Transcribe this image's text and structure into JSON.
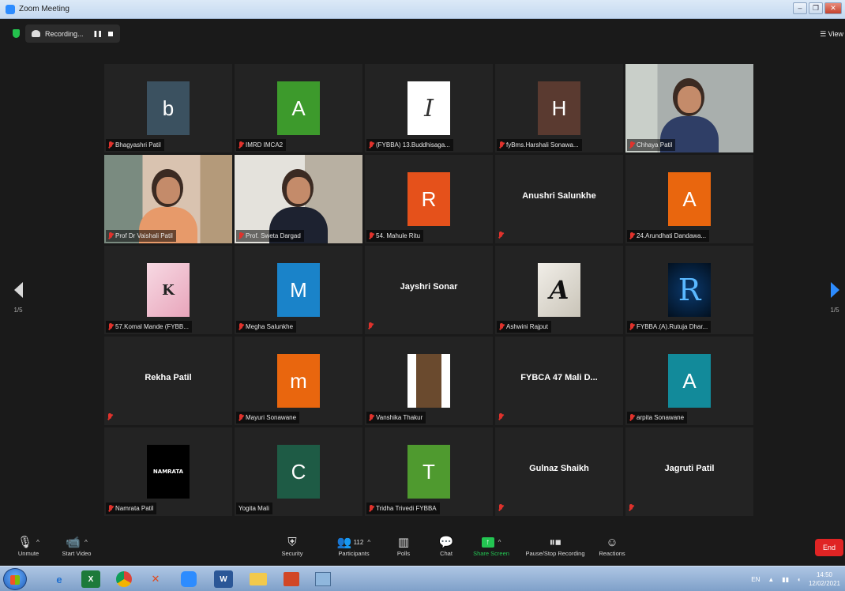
{
  "window": {
    "title": "Zoom Meeting"
  },
  "meeting_bar": {
    "recording_label": "Recording...",
    "view_label": "View"
  },
  "nav": {
    "left_page": "1/5",
    "right_page": "1/5"
  },
  "tiles": [
    {
      "kind": "avatar",
      "name": "Bhagyashri Patil",
      "letter": "b",
      "color": "#3b5160"
    },
    {
      "kind": "avatar",
      "name": "IMRD IMCA2",
      "letter": "A",
      "color": "#3d9a2c"
    },
    {
      "kind": "pic",
      "name": "(FYBBA) 13.Buddhisaga...",
      "icon": "floral-letter-i"
    },
    {
      "kind": "avatar",
      "name": "fyBms.Harshali Sonawa...",
      "letter": "H",
      "color": "#5a3a30"
    },
    {
      "kind": "video",
      "name": "Chhaya Patil",
      "icon": "participant-video"
    },
    {
      "kind": "video",
      "name": "Prof Dr Vaishali Patil",
      "icon": "participant-video"
    },
    {
      "kind": "video",
      "name": "Prof. Sweta Dargad",
      "icon": "participant-video",
      "active": true
    },
    {
      "kind": "avatar",
      "name": "54. Mahule Ritu",
      "letter": "R",
      "color": "#e5511b"
    },
    {
      "kind": "text",
      "name": "",
      "big": "Anushri Salunkhe"
    },
    {
      "kind": "avatar",
      "name": "24.Arundhati Dandawa...",
      "letter": "A",
      "color": "#e9660e"
    },
    {
      "kind": "pic",
      "name": "57.Komal Mande (FYBB...",
      "icon": "floral-letter-k"
    },
    {
      "kind": "avatar",
      "name": "Megha Salunkhe",
      "letter": "M",
      "color": "#1a83c9"
    },
    {
      "kind": "text",
      "name": "",
      "big": "Jayshri Sonar"
    },
    {
      "kind": "pic",
      "name": "Ashwini Rajput",
      "icon": "letter-a-art"
    },
    {
      "kind": "pic",
      "name": "FYBBA.(A).Rutuja Dhar...",
      "icon": "neon-letter-r"
    },
    {
      "kind": "text",
      "name": "",
      "big": "Rekha Patil"
    },
    {
      "kind": "avatar",
      "name": "Mayuri Sonawane",
      "letter": "m",
      "color": "#e9660e"
    },
    {
      "kind": "pic",
      "name": "Vanshika Thakur",
      "icon": "photo-image"
    },
    {
      "kind": "text",
      "name": "",
      "big": "FYBCA 47 Mali D..."
    },
    {
      "kind": "avatar",
      "name": "arpita Sonawane",
      "letter": "A",
      "color": "#128a9a"
    },
    {
      "kind": "pic",
      "name": "Namrata Patil",
      "icon": "namrata-logo",
      "logo_text": "NAMRATA"
    },
    {
      "kind": "avatar",
      "name": "Yogita Mali",
      "letter": "C",
      "color": "#1e5b45",
      "muted": false
    },
    {
      "kind": "avatar",
      "name": "Tridha Trivedi FYBBA",
      "letter": "T",
      "color": "#4f9a2f"
    },
    {
      "kind": "text",
      "name": "",
      "big": "Gulnaz Shaikh"
    },
    {
      "kind": "text",
      "name": "",
      "big": "Jagruti Patil"
    }
  ],
  "toolbar": {
    "unmute": "Unmute",
    "start_video": "Start Video",
    "security": "Security",
    "participants": "Participants",
    "participants_count": "112",
    "polls": "Polls",
    "chat": "Chat",
    "share_screen": "Share Screen",
    "pause_stop_recording": "Pause/Stop Recording",
    "reactions": "Reactions",
    "end": "End"
  },
  "taskbar": {
    "lang": "EN",
    "time": "14:50",
    "date": "12/02/2021"
  },
  "colors": {
    "accent": "#2d8cff",
    "share_green": "#23c552",
    "end_red": "#e02424",
    "active_border": "#cfd65a"
  }
}
